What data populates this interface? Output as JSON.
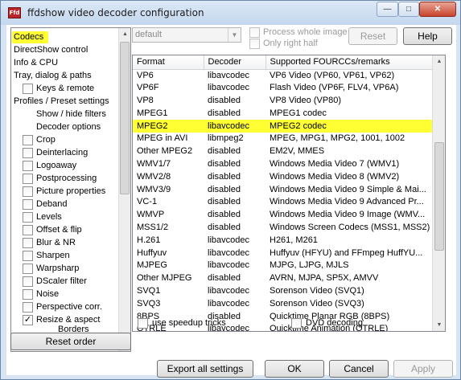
{
  "window": {
    "title": "ffdshow video decoder configuration",
    "icon_text": "Ffd",
    "controls": {
      "minimize": "—",
      "maximize": "□",
      "close": "✕"
    }
  },
  "sidebar": {
    "items": [
      {
        "label": "Codecs",
        "highlighted": true
      },
      {
        "label": "DirectShow control"
      },
      {
        "label": "Info & CPU"
      },
      {
        "label": "Tray, dialog & paths"
      },
      {
        "label": "Keys & remote",
        "checkbox": true,
        "checked": false
      },
      {
        "label": "Profiles / Preset settings"
      },
      {
        "label": "Show / hide filters"
      },
      {
        "label": "Decoder options"
      },
      {
        "label": "Crop",
        "checkbox": true,
        "checked": false
      },
      {
        "label": "Deinterlacing",
        "checkbox": true,
        "checked": false
      },
      {
        "label": "Logoaway",
        "checkbox": true,
        "checked": false
      },
      {
        "label": "Postprocessing",
        "checkbox": true,
        "checked": false
      },
      {
        "label": "Picture properties",
        "checkbox": true,
        "checked": false
      },
      {
        "label": "Deband",
        "checkbox": true,
        "checked": false
      },
      {
        "label": "Levels",
        "checkbox": true,
        "checked": false
      },
      {
        "label": "Offset & flip",
        "checkbox": true,
        "checked": false
      },
      {
        "label": "Blur & NR",
        "checkbox": true,
        "checked": false
      },
      {
        "label": "Sharpen",
        "checkbox": true,
        "checked": false
      },
      {
        "label": "Warpsharp",
        "checkbox": true,
        "checked": false
      },
      {
        "label": "DScaler filter",
        "checkbox": true,
        "checked": false
      },
      {
        "label": "Noise",
        "checkbox": true,
        "checked": false
      },
      {
        "label": "Perspective corr.",
        "checkbox": true,
        "checked": false
      },
      {
        "label": "Resize & aspect",
        "checkbox": true,
        "checked": true
      },
      {
        "label": "Borders"
      }
    ],
    "reset_order": "Reset order"
  },
  "top": {
    "preset_value": "default",
    "process_whole_image": "Process whole image",
    "only_right_half": "Only right half",
    "reset": "Reset",
    "help": "Help"
  },
  "table": {
    "headers": [
      "Format",
      "Decoder",
      "Supported FOURCCs/remarks"
    ],
    "rows": [
      [
        "VP6",
        "libavcodec",
        "VP6 Video (VP60, VP61, VP62)"
      ],
      [
        "VP6F",
        "libavcodec",
        "Flash Video (VP6F, FLV4, VP6A)"
      ],
      [
        "VP8",
        "disabled",
        "VP8 Video (VP80)"
      ],
      [
        "MPEG1",
        "disabled",
        "MPEG1 codec"
      ],
      [
        "MPEG2",
        "libavcodec",
        "MPEG2 codec"
      ],
      [
        "MPEG in AVI",
        "libmpeg2",
        "MPEG, MPG1, MPG2, 1001, 1002"
      ],
      [
        "Other MPEG2",
        "disabled",
        "EM2V, MMES"
      ],
      [
        "WMV1/7",
        "disabled",
        "Windows Media Video 7 (WMV1)"
      ],
      [
        "WMV2/8",
        "disabled",
        "Windows Media Video 8 (WMV2)"
      ],
      [
        "WMV3/9",
        "disabled",
        "Windows Media Video 9 Simple & Mai..."
      ],
      [
        "VC-1",
        "disabled",
        "Windows Media Video 9 Advanced Pr..."
      ],
      [
        "WMVP",
        "disabled",
        "Windows Media Video 9 Image (WMV..."
      ],
      [
        "MSS1/2",
        "disabled",
        "Windows Screen Codecs (MSS1, MSS2)"
      ],
      [
        "H.261",
        "libavcodec",
        "H261, M261"
      ],
      [
        "Huffyuv",
        "libavcodec",
        "Huffyuv (HFYU) and FFmpeg HuffYU..."
      ],
      [
        "MJPEG",
        "libavcodec",
        "MJPG, LJPG, MJLS"
      ],
      [
        "Other MJPEG",
        "disabled",
        "AVRN, MJPA, SP5X, AMVV"
      ],
      [
        "SVQ1",
        "libavcodec",
        "Sorenson Video (SVQ1)"
      ],
      [
        "SVQ3",
        "libavcodec",
        "Sorenson Video (SVQ3)"
      ],
      [
        "8BPS",
        "disabled",
        "Quicktime Planar RGB (8BPS)"
      ],
      [
        "QTRLE",
        "libavcodec",
        "Quicktime Animation (QTRLE)"
      ]
    ],
    "highlight_row": 4
  },
  "options": {
    "use_speedup_tricks": "use speedup tricks",
    "dvd_decoding": "DVD decoding"
  },
  "footer": {
    "export": "Export all settings",
    "ok": "OK",
    "cancel": "Cancel",
    "apply": "Apply"
  },
  "colors": {
    "highlight": "#ffff33"
  }
}
